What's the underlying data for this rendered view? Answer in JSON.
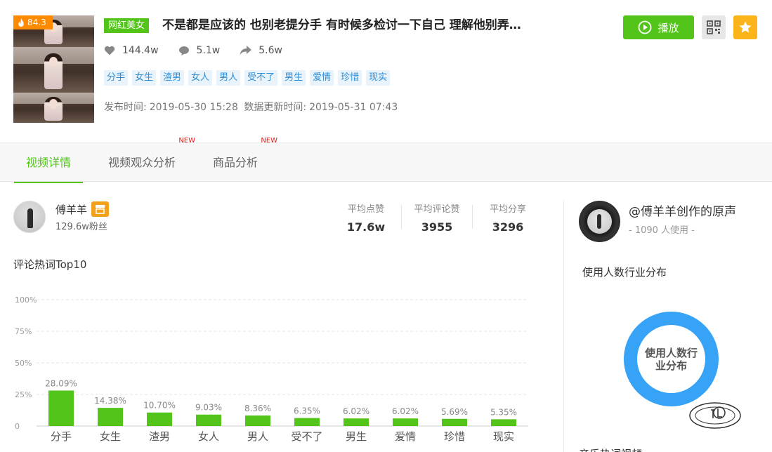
{
  "header": {
    "heat_score": "84.3",
    "category_tag": "网红美女",
    "title": "不是都是应该的 也别老提分手 有时候多检讨一下自己 理解他别弄…",
    "likes": "144.4w",
    "comments": "5.1w",
    "shares": "5.6w",
    "keywords": [
      "分手",
      "女生",
      "渣男",
      "女人",
      "男人",
      "受不了",
      "男生",
      "爱情",
      "珍惜",
      "现实"
    ],
    "publish_label": "发布时间:",
    "publish_time": "2019-05-30 15:28",
    "update_label": "数据更新时间:",
    "update_time": "2019-05-31 07:43",
    "play_label": "播放"
  },
  "tabs": [
    {
      "label": "视频详情",
      "active": true,
      "new": ""
    },
    {
      "label": "视频观众分析",
      "active": false,
      "new": "NEW"
    },
    {
      "label": "商品分析",
      "active": false,
      "new": "NEW"
    }
  ],
  "author": {
    "name": "傅羊羊",
    "fans": "129.6w粉丝"
  },
  "averages": [
    {
      "label": "平均点赞",
      "value": "17.6w"
    },
    {
      "label": "平均评论赞",
      "value": "3955"
    },
    {
      "label": "平均分享",
      "value": "3296"
    }
  ],
  "comment_section_title": "评论热词Top10",
  "chart_data": {
    "type": "bar",
    "title": "",
    "xlabel": "",
    "ylabel": "",
    "ylim": [
      0,
      100
    ],
    "yticks": [
      "0",
      "25%",
      "50%",
      "75%",
      "100%"
    ],
    "categories": [
      "分手",
      "女生",
      "渣男",
      "女人",
      "男人",
      "受不了",
      "男生",
      "爱情",
      "珍惜",
      "现实"
    ],
    "values": [
      28.09,
      14.38,
      10.7,
      9.03,
      8.36,
      6.35,
      6.02,
      6.02,
      5.69,
      5.35
    ],
    "labels": [
      "28.09%",
      "14.38%",
      "10.70%",
      "9.03%",
      "8.36%",
      "6.35%",
      "6.02%",
      "6.02%",
      "5.69%",
      "5.35%"
    ],
    "bar_color": "#52c41a",
    "grid": true
  },
  "music": {
    "name": "@傅羊羊创作的原声",
    "users": "- 1090 人使用 -",
    "industry_title": "使用人数行业分布",
    "donut_label": "使用人数行业分布",
    "donut_color": "#36a3f7",
    "bottom_title": "音乐热词视频"
  },
  "colors": {
    "accent": "#52c41a",
    "heat": "#ff8a00",
    "favorite": "#fbb51a",
    "keyword_bg": "#e8f3fc",
    "keyword_text": "#2f8fd6"
  }
}
